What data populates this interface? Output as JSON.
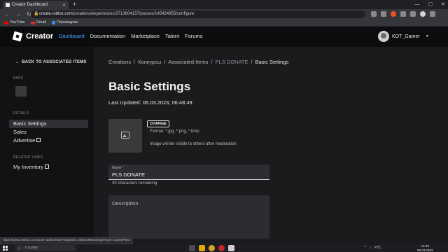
{
  "browser": {
    "tab_title": "Creator Dashboard",
    "url_host": "create.roblox.com",
    "url_path": "/creations/experiences/3713604157/passes/145424955/configure",
    "bookmarks": [
      "YouTube",
      "Gmail",
      "Переводчик"
    ]
  },
  "topnav": {
    "brand": "Creator",
    "links": [
      "Dashboard",
      "Documentation",
      "Marketplace",
      "Talent",
      "Forums"
    ],
    "active_link": "Dashboard",
    "username": "KOT_Gamer",
    "accent_color": "#4aa3ff"
  },
  "sidebar": {
    "back_label": "BACK TO ASSOCIATED ITEMS",
    "pass_label": "PASS",
    "details_label": "DETAILS",
    "items": [
      "Basic Settings",
      "Sales",
      "Advertise"
    ],
    "selected_item": "Basic Settings",
    "related_label": "RELATED LINKS",
    "related_items": [
      "My Inventory"
    ]
  },
  "breadcrumb": [
    "Creations",
    "Конкурсы",
    "Associated Items",
    "PLS DONATE",
    "Basic Settings"
  ],
  "main": {
    "title": "Basic Settings",
    "last_updated": "Last Updated: 06.03.2023, 06:48:49",
    "change_button": "CHANGE",
    "format_text": "Format: *.jpg, *.png, *.bmp",
    "visibility_text": "Image will be visible to others after moderation",
    "name_label": "Name *",
    "name_value": "PLS DONATE",
    "name_remaining": "40 characters remaining",
    "description_placeholder": "Description"
  },
  "status_url": "https://www.roblox.com/user-ads/create?targetId=145424955&targetType=GamePass",
  "taskbar": {
    "search_placeholder": "Ссылки",
    "lang": "РУС",
    "time": "12:48",
    "date": "06.03.2023"
  }
}
